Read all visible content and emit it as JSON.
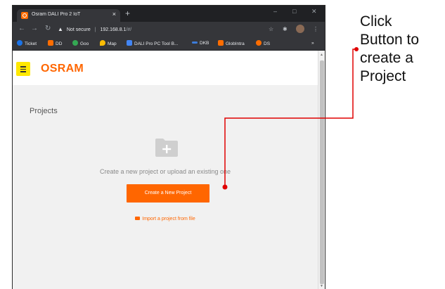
{
  "browser": {
    "tab_title": "Osram DALI Pro 2 IoT",
    "tab_close": "×",
    "new_tab": "+",
    "window_controls": [
      "–",
      "□",
      "✕"
    ],
    "security_label": "Not secure",
    "url_host": "192.168.8.1",
    "url_path": "/#/",
    "bookmarks": [
      {
        "label": "Ticket",
        "color": "#1a73e8"
      },
      {
        "label": "DD",
        "color": "#ff6d00"
      },
      {
        "label": "Goo",
        "color": "#34a853"
      },
      {
        "label": "Map",
        "color": "#fbbc04"
      },
      {
        "label": "DALI Pro PC Tool B...",
        "color": "#4285f4"
      },
      {
        "label": "DKB",
        "color": "#3c7dd9"
      },
      {
        "label": "GlobIntra",
        "color": "#ff6d00"
      },
      {
        "label": "DS",
        "color": "#ff6d00"
      }
    ],
    "bookmarks_more": "»"
  },
  "app": {
    "logo": "OSRAM",
    "section_title": "Projects",
    "empty_text": "Create a new project or upload an existing one",
    "create_button": "Create a New Project",
    "import_link": "Import a project from file"
  },
  "annotation": {
    "lines": [
      "Click",
      "Button to",
      "create a",
      "Project"
    ]
  },
  "colors": {
    "accent": "#ff6600",
    "menu": "#ffe800",
    "callout": "#e00000"
  }
}
